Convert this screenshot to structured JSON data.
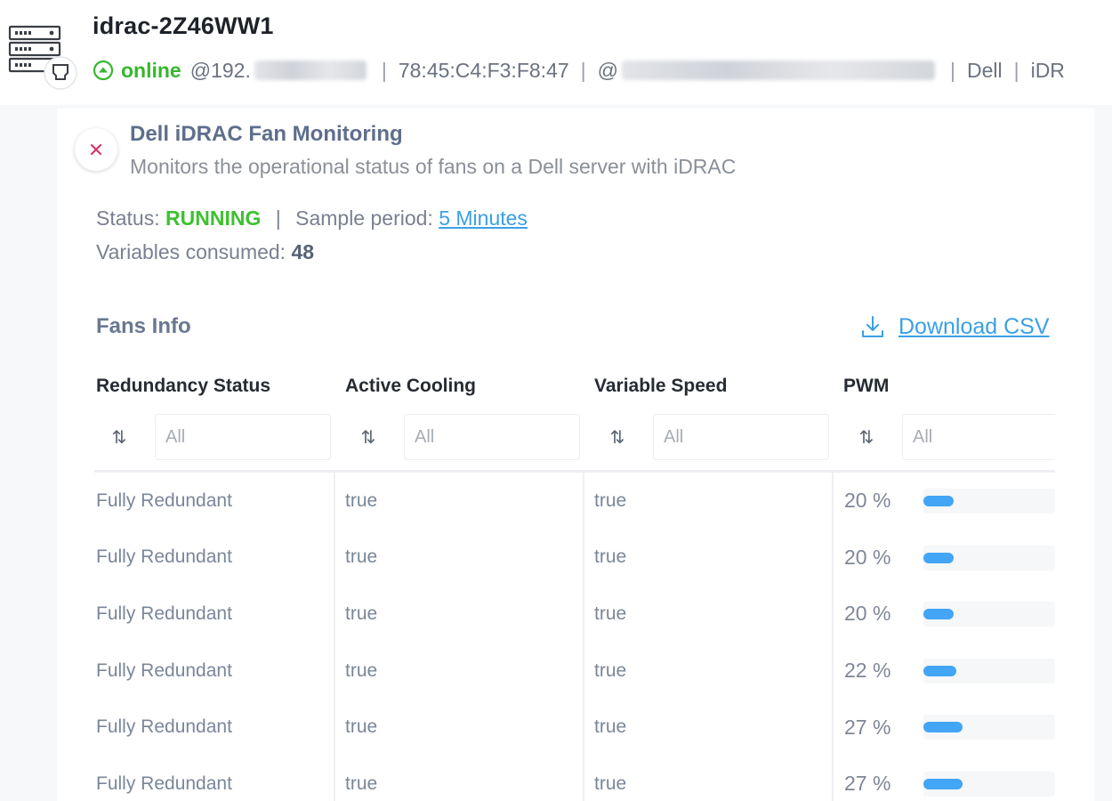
{
  "device": {
    "name": "idrac-2Z46WW1",
    "status": "online",
    "ip_prefix": "@192.",
    "mac": "78:45:C4:F3:F8:47",
    "host_prefix": "@",
    "vendor": "Dell",
    "model_partial": "iDR"
  },
  "monitor": {
    "title": "Dell iDRAC Fan Monitoring",
    "description": "Monitors the operational status of fans on a Dell server with iDRAC",
    "status_label": "Status:",
    "status_value": "RUNNING",
    "sample_label": "Sample period:",
    "sample_value": "5 Minutes",
    "vars_label": "Variables consumed:",
    "vars_value": "48"
  },
  "fans": {
    "section_title": "Fans Info",
    "download_label": "Download CSV",
    "filter_placeholder": "All",
    "columns": [
      "Redundancy Status",
      "Active Cooling",
      "Variable Speed",
      "PWM"
    ],
    "rows": [
      {
        "redundancy": "Fully Redundant",
        "active_cooling": "true",
        "variable_speed": "true",
        "pwm": "20 %",
        "pwm_value": 20
      },
      {
        "redundancy": "Fully Redundant",
        "active_cooling": "true",
        "variable_speed": "true",
        "pwm": "20 %",
        "pwm_value": 20
      },
      {
        "redundancy": "Fully Redundant",
        "active_cooling": "true",
        "variable_speed": "true",
        "pwm": "20 %",
        "pwm_value": 20
      },
      {
        "redundancy": "Fully Redundant",
        "active_cooling": "true",
        "variable_speed": "true",
        "pwm": "22 %",
        "pwm_value": 22
      },
      {
        "redundancy": "Fully Redundant",
        "active_cooling": "true",
        "variable_speed": "true",
        "pwm": "27 %",
        "pwm_value": 27
      },
      {
        "redundancy": "Fully Redundant",
        "active_cooling": "true",
        "variable_speed": "true",
        "pwm": "27 %",
        "pwm_value": 27
      }
    ]
  },
  "colors": {
    "online": "#36b82c",
    "running": "#3ec130",
    "link": "#3aa0e6",
    "bar": "#42a5f5",
    "close": "#d6336c"
  },
  "icons": {
    "device": "server-rack-icon",
    "online": "online-arrow-icon",
    "close": "close-icon",
    "download": "download-icon",
    "sort": "sort-icon"
  }
}
